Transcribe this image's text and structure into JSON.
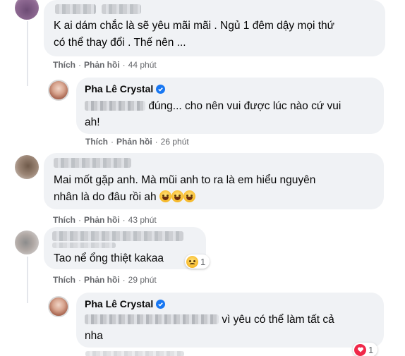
{
  "comments": [
    {
      "text_lines": [
        "K ai dám chắc là sẽ yêu mãi mãi . Ngủ 1 đêm dậy mọi thứ",
        "có thể thay đổi . Thế nên ..."
      ],
      "actions": {
        "like": "Thích",
        "reply": "Phản hồi",
        "time": "44 phút"
      }
    },
    {
      "author": "Pha Lê Crystal",
      "text_lines": [
        "đúng... cho nên vui được lúc nào cứ vui",
        "ah!"
      ],
      "actions": {
        "like": "Thích",
        "reply": "Phản hồi",
        "time": "26 phút"
      }
    },
    {
      "text_lines": [
        "Mai mốt gặp anh. Mà mũi anh to ra là em hiểu nguyên",
        "nhân là do đâu rồi ah"
      ],
      "actions": {
        "like": "Thích",
        "reply": "Phản hồi",
        "time": "43 phút"
      }
    },
    {
      "text_lines": [
        "Tao nể ổng thiệt kakaa"
      ],
      "reaction_count": "1",
      "actions": {
        "like": "Thích",
        "reply": "Phản hồi",
        "time": "29 phút"
      }
    },
    {
      "author": "Pha Lê Crystal",
      "text_lines": [
        "vì yêu có thể làm tất cả",
        "nha"
      ],
      "reaction_count": "1"
    }
  ],
  "colors": {
    "bubble": "#f0f2f5",
    "meta": "#65676b",
    "verified": "#1877f2",
    "heart": "#f02849"
  },
  "icons": [
    "verified-badge-icon",
    "laughing-emoji-icon",
    "sad-emoji-icon",
    "heart-reaction-icon"
  ]
}
